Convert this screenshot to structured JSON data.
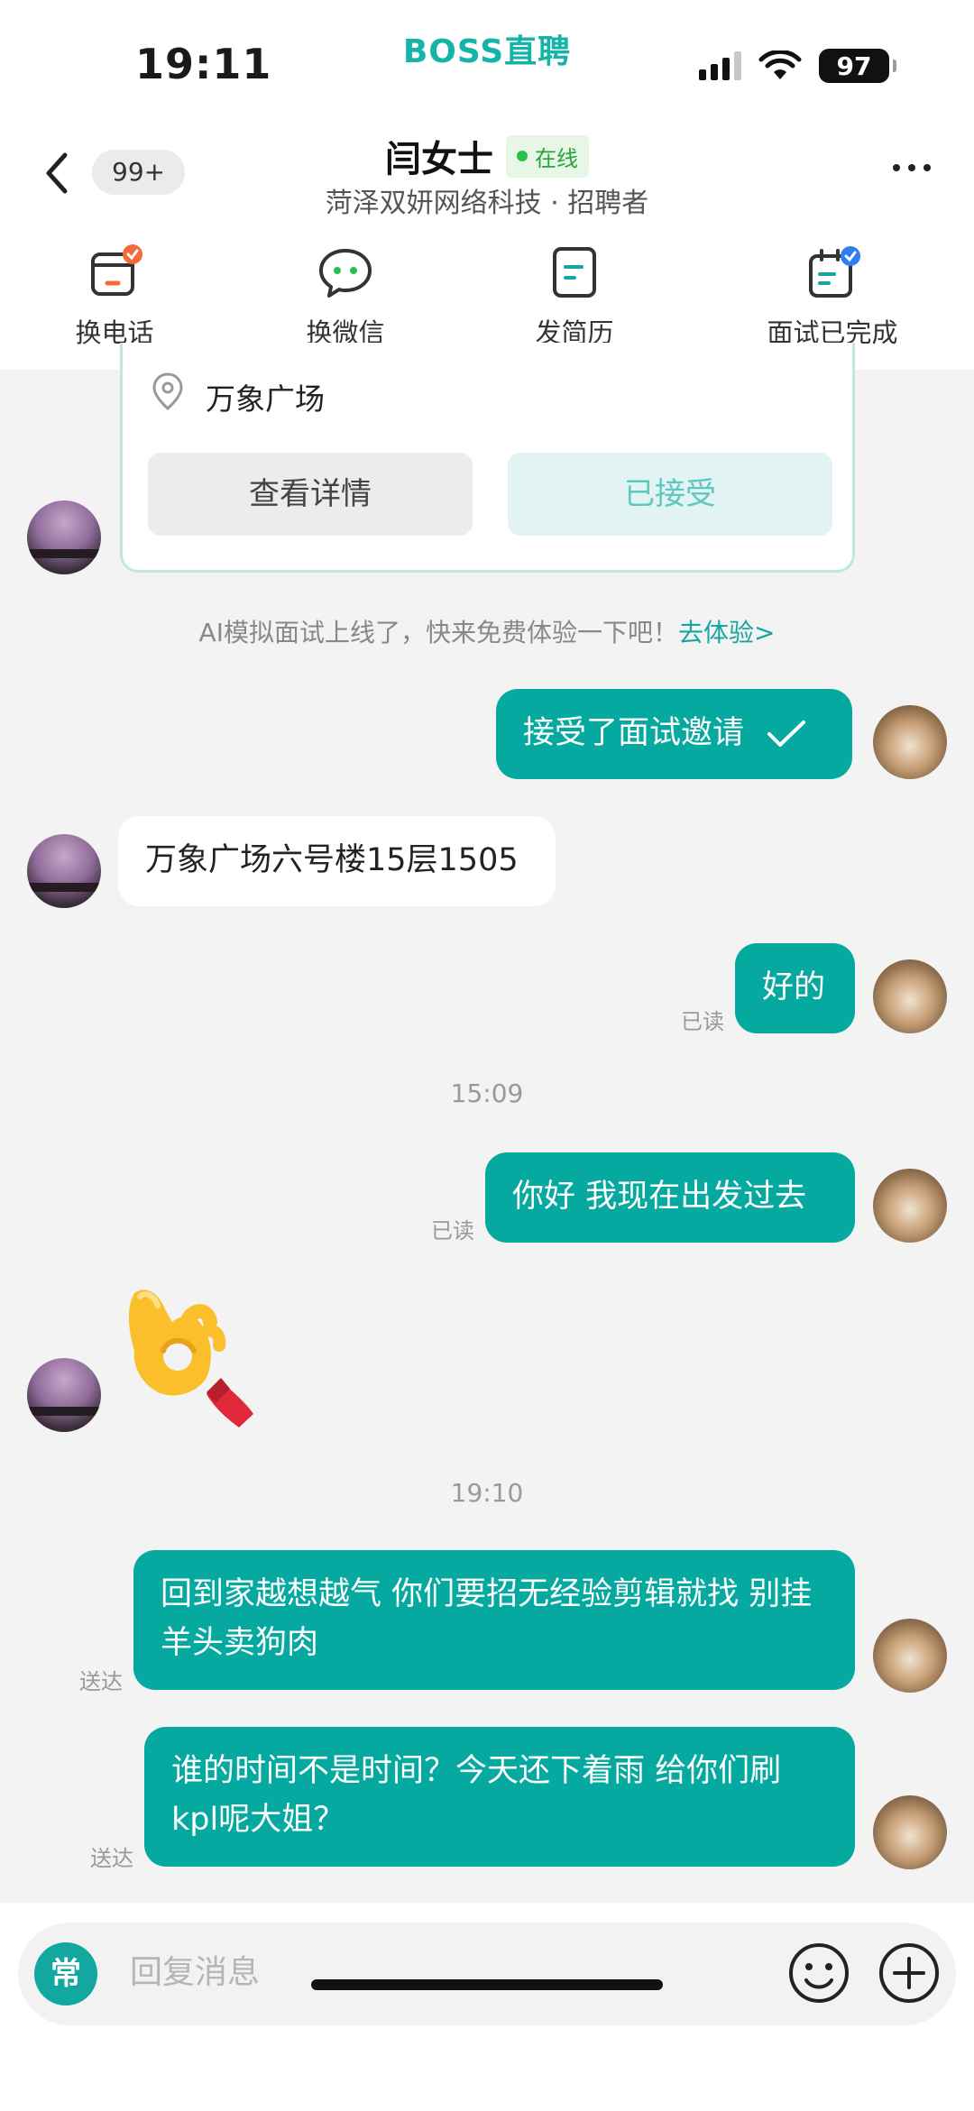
{
  "status_bar": {
    "time": "19:11",
    "app_name": "BOSS直聘",
    "battery": "97"
  },
  "header": {
    "back_icon": "chevron-left-icon",
    "unread_badge": "99+",
    "contact_name": "闫女士",
    "online_label": "在线",
    "company_line": "菏泽双妍网络科技 · 招聘者",
    "more_icon": "more-dots-icon"
  },
  "actions": [
    {
      "label": "换电话",
      "icon": "phone-exchange-icon"
    },
    {
      "label": "换微信",
      "icon": "wechat-icon"
    },
    {
      "label": "发简历",
      "icon": "resume-icon"
    },
    {
      "label": "面试已完成",
      "icon": "interview-done-icon"
    }
  ],
  "invite_card": {
    "location": "万象广场",
    "detail_button": "查看详情",
    "accepted_button": "已接受"
  },
  "system_note": {
    "text": "AI模拟面试上线了，快来免费体验一下吧！",
    "link": "去体验>"
  },
  "messages": [
    {
      "from": "me",
      "text": "接受了面试邀请"
    },
    {
      "from": "them",
      "text": "万象广场六号楼15层1505"
    },
    {
      "from": "me",
      "text": "好的",
      "status": "已读"
    },
    {
      "type": "time",
      "text": "15:09"
    },
    {
      "from": "me",
      "text": "你好 我现在出发过去",
      "status": "已读"
    },
    {
      "from": "them",
      "emoji": "ok-hand-emoji"
    },
    {
      "type": "time",
      "text": "19:10"
    },
    {
      "from": "me",
      "text": "回到家越想越气 你们要招无经验剪辑就找 别挂羊头卖狗肉",
      "status": "送达"
    },
    {
      "from": "me",
      "text": "谁的时间不是时间？今天还下着雨 给你们刷kpl呢大姐？",
      "status": "送达"
    }
  ],
  "input_bar": {
    "quick_label": "常",
    "placeholder": "回复消息",
    "emoji_icon": "smiley-icon",
    "plus_icon": "plus-circle-icon"
  },
  "colors": {
    "accent": "#06a99f",
    "brand": "#16b3a9",
    "online": "#27a53c"
  }
}
